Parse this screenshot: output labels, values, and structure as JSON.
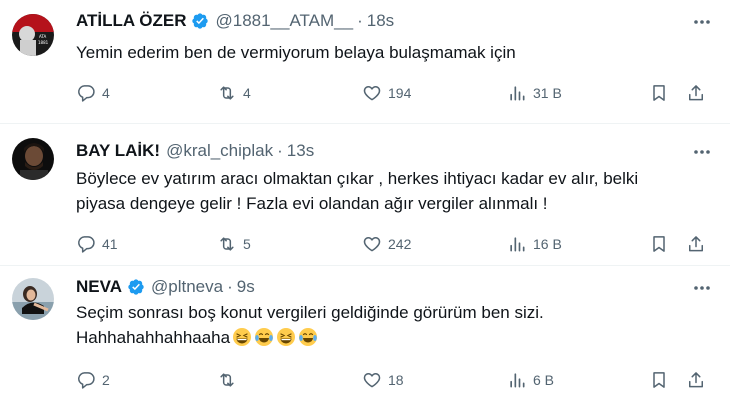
{
  "tweets": [
    {
      "name": "ATİLLA ÖZER",
      "verified": true,
      "handle": "@1881__ATAM__",
      "time": "18s",
      "text": "Yemin ederim ben de vermiyorum belaya bulaşmamak için",
      "replies": "4",
      "retweets": "4",
      "likes": "194",
      "views": "31 B"
    },
    {
      "name": "BAY LAİK!",
      "verified": false,
      "handle": "@kral_chiplak",
      "time": "13s",
      "text_line1": "Böylece ev yatırım aracı olmaktan çıkar , herkes ihtiyacı kadar ev alır, belki",
      "text_line2": "piyasa dengeye gelir ! Fazla evi olandan ağır vergiler alınmalı !",
      "replies": "41",
      "retweets": "5",
      "likes": "242",
      "views": "16 B"
    },
    {
      "name": "NEVA",
      "verified": true,
      "handle": "@pltneva",
      "time": "9s",
      "text_line1": "Seçim sonrası boş konut vergileri geldiğinde görürüm ben sizi.",
      "text_line2": "Hahhahahhahhaaha",
      "emojis": [
        "grinning-squinting-face",
        "face-with-tears-of-joy",
        "grinning-squinting-face",
        "face-with-tears-of-joy"
      ],
      "replies": "2",
      "retweets": "",
      "likes": "18",
      "views": "6 B"
    }
  ],
  "colors": {
    "text": "#0f1419",
    "secondary": "#536471",
    "verified": "#1d9bf0",
    "divider": "#eff3f4"
  }
}
